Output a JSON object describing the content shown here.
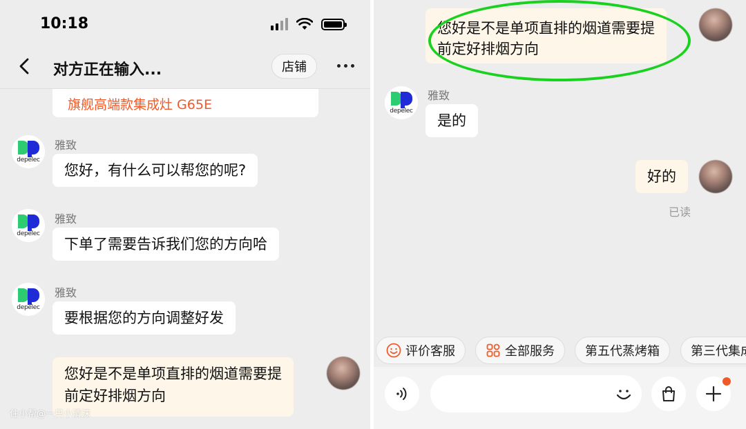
{
  "left": {
    "status_bar": {
      "time": "10:18"
    },
    "header": {
      "title": "对方正在输入...",
      "shop_button": "店铺"
    },
    "product_card_text": "旗舰高端款集成灶 G65E",
    "messages": [
      {
        "sender": "雅致",
        "text": "您好，有什么可以帮您的呢?"
      },
      {
        "sender": "雅致",
        "text": "下单了需要告诉我们您的方向哈"
      },
      {
        "sender": "雅致",
        "text": "要根据您的方向调整好发"
      }
    ],
    "user_message": {
      "line1": "您好是不是单项直排的烟道需要提",
      "line2": "前定好排烟方向"
    },
    "brand_word": "depelec",
    "watermark": "住小帮@一只小清沫"
  },
  "right": {
    "user_message_top": {
      "line1": "您好是不是单项直排的烟道需要提",
      "line2": "前定好排烟方向"
    },
    "merchant_sender": "雅致",
    "merchant_reply": "是的",
    "user_reply": "好的",
    "read_status": "已读",
    "quick_actions": [
      {
        "label": "评价客服",
        "icon": "smile-icon"
      },
      {
        "label": "全部服务",
        "icon": "grid-icon"
      },
      {
        "label": "第五代蒸烤箱"
      },
      {
        "label": "第三代集成"
      }
    ],
    "input": {
      "placeholder": ""
    }
  },
  "colors": {
    "background": "#ededed",
    "cream_bubble": "#fdf6e9",
    "accent_orange": "#f05a28",
    "highlight_green": "#19d11e",
    "logo_green": "#2ecc71",
    "logo_blue": "#1e2bd6"
  }
}
